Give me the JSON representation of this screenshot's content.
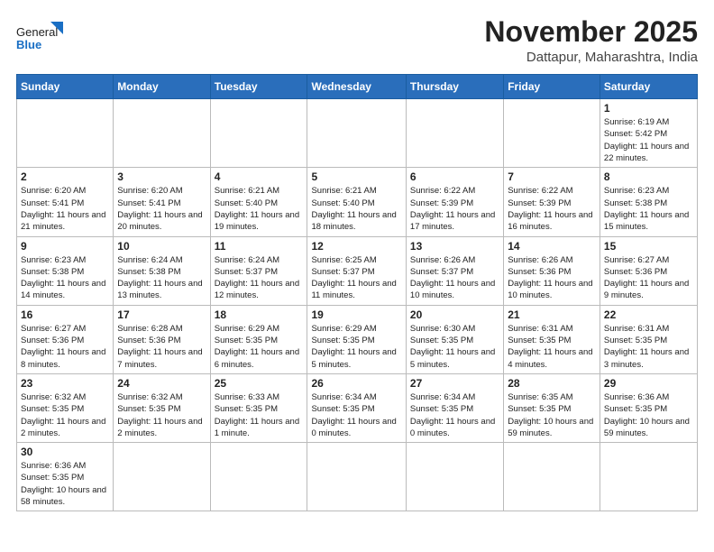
{
  "header": {
    "logo_general": "General",
    "logo_blue": "Blue",
    "month_title": "November 2025",
    "location": "Dattapur, Maharashtra, India"
  },
  "days_of_week": [
    "Sunday",
    "Monday",
    "Tuesday",
    "Wednesday",
    "Thursday",
    "Friday",
    "Saturday"
  ],
  "weeks": [
    [
      {
        "day": "",
        "info": ""
      },
      {
        "day": "",
        "info": ""
      },
      {
        "day": "",
        "info": ""
      },
      {
        "day": "",
        "info": ""
      },
      {
        "day": "",
        "info": ""
      },
      {
        "day": "",
        "info": ""
      },
      {
        "day": "1",
        "info": "Sunrise: 6:19 AM\nSunset: 5:42 PM\nDaylight: 11 hours and 22 minutes."
      }
    ],
    [
      {
        "day": "2",
        "info": "Sunrise: 6:20 AM\nSunset: 5:41 PM\nDaylight: 11 hours and 21 minutes."
      },
      {
        "day": "3",
        "info": "Sunrise: 6:20 AM\nSunset: 5:41 PM\nDaylight: 11 hours and 20 minutes."
      },
      {
        "day": "4",
        "info": "Sunrise: 6:21 AM\nSunset: 5:40 PM\nDaylight: 11 hours and 19 minutes."
      },
      {
        "day": "5",
        "info": "Sunrise: 6:21 AM\nSunset: 5:40 PM\nDaylight: 11 hours and 18 minutes."
      },
      {
        "day": "6",
        "info": "Sunrise: 6:22 AM\nSunset: 5:39 PM\nDaylight: 11 hours and 17 minutes."
      },
      {
        "day": "7",
        "info": "Sunrise: 6:22 AM\nSunset: 5:39 PM\nDaylight: 11 hours and 16 minutes."
      },
      {
        "day": "8",
        "info": "Sunrise: 6:23 AM\nSunset: 5:38 PM\nDaylight: 11 hours and 15 minutes."
      }
    ],
    [
      {
        "day": "9",
        "info": "Sunrise: 6:23 AM\nSunset: 5:38 PM\nDaylight: 11 hours and 14 minutes."
      },
      {
        "day": "10",
        "info": "Sunrise: 6:24 AM\nSunset: 5:38 PM\nDaylight: 11 hours and 13 minutes."
      },
      {
        "day": "11",
        "info": "Sunrise: 6:24 AM\nSunset: 5:37 PM\nDaylight: 11 hours and 12 minutes."
      },
      {
        "day": "12",
        "info": "Sunrise: 6:25 AM\nSunset: 5:37 PM\nDaylight: 11 hours and 11 minutes."
      },
      {
        "day": "13",
        "info": "Sunrise: 6:26 AM\nSunset: 5:37 PM\nDaylight: 11 hours and 10 minutes."
      },
      {
        "day": "14",
        "info": "Sunrise: 6:26 AM\nSunset: 5:36 PM\nDaylight: 11 hours and 10 minutes."
      },
      {
        "day": "15",
        "info": "Sunrise: 6:27 AM\nSunset: 5:36 PM\nDaylight: 11 hours and 9 minutes."
      }
    ],
    [
      {
        "day": "16",
        "info": "Sunrise: 6:27 AM\nSunset: 5:36 PM\nDaylight: 11 hours and 8 minutes."
      },
      {
        "day": "17",
        "info": "Sunrise: 6:28 AM\nSunset: 5:36 PM\nDaylight: 11 hours and 7 minutes."
      },
      {
        "day": "18",
        "info": "Sunrise: 6:29 AM\nSunset: 5:35 PM\nDaylight: 11 hours and 6 minutes."
      },
      {
        "day": "19",
        "info": "Sunrise: 6:29 AM\nSunset: 5:35 PM\nDaylight: 11 hours and 5 minutes."
      },
      {
        "day": "20",
        "info": "Sunrise: 6:30 AM\nSunset: 5:35 PM\nDaylight: 11 hours and 5 minutes."
      },
      {
        "day": "21",
        "info": "Sunrise: 6:31 AM\nSunset: 5:35 PM\nDaylight: 11 hours and 4 minutes."
      },
      {
        "day": "22",
        "info": "Sunrise: 6:31 AM\nSunset: 5:35 PM\nDaylight: 11 hours and 3 minutes."
      }
    ],
    [
      {
        "day": "23",
        "info": "Sunrise: 6:32 AM\nSunset: 5:35 PM\nDaylight: 11 hours and 2 minutes."
      },
      {
        "day": "24",
        "info": "Sunrise: 6:32 AM\nSunset: 5:35 PM\nDaylight: 11 hours and 2 minutes."
      },
      {
        "day": "25",
        "info": "Sunrise: 6:33 AM\nSunset: 5:35 PM\nDaylight: 11 hours and 1 minute."
      },
      {
        "day": "26",
        "info": "Sunrise: 6:34 AM\nSunset: 5:35 PM\nDaylight: 11 hours and 0 minutes."
      },
      {
        "day": "27",
        "info": "Sunrise: 6:34 AM\nSunset: 5:35 PM\nDaylight: 11 hours and 0 minutes."
      },
      {
        "day": "28",
        "info": "Sunrise: 6:35 AM\nSunset: 5:35 PM\nDaylight: 10 hours and 59 minutes."
      },
      {
        "day": "29",
        "info": "Sunrise: 6:36 AM\nSunset: 5:35 PM\nDaylight: 10 hours and 59 minutes."
      }
    ],
    [
      {
        "day": "30",
        "info": "Sunrise: 6:36 AM\nSunset: 5:35 PM\nDaylight: 10 hours and 58 minutes."
      },
      {
        "day": "",
        "info": ""
      },
      {
        "day": "",
        "info": ""
      },
      {
        "day": "",
        "info": ""
      },
      {
        "day": "",
        "info": ""
      },
      {
        "day": "",
        "info": ""
      },
      {
        "day": "",
        "info": ""
      }
    ]
  ]
}
